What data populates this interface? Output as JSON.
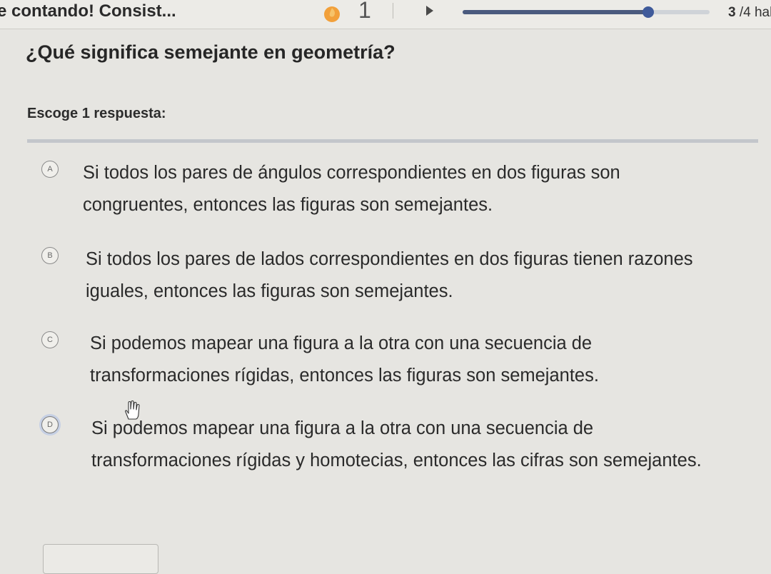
{
  "header": {
    "exercise_title": "e contando! Consist...",
    "streak_count": "1",
    "progress_fraction": 0.75,
    "counter_current": "3",
    "counter_rest": " /4 hab"
  },
  "question": {
    "prompt": "¿Qué signiﬁca semejante en geometría?",
    "instruction": "Escoge 1 respuesta:"
  },
  "choices": [
    {
      "letter": "A",
      "text": "Si todos los pares de ángulos correspondientes en dos ﬁguras son congruentes, entonces las ﬁguras son semejantes."
    },
    {
      "letter": "B",
      "text": "Si todos los pares de lados correspondientes en dos ﬁguras tienen razones iguales, entonces las ﬁguras son semejantes."
    },
    {
      "letter": "C",
      "text": "Si podemos mapear una ﬁgura a la otra con una secuencia de transformaciones rígidas, entonces las ﬁguras son semejantes."
    },
    {
      "letter": "D",
      "text": "Si podemos mapear una ﬁgura a la otra con una secuencia de transformaciones rígidas y homotecias, entonces las cifras son semejantes."
    }
  ],
  "colors": {
    "progress_fill": "#4a5a7e",
    "progress_knob": "#3f5a9a",
    "streak_flame": "#f2a03a"
  },
  "icons": {
    "streak": "flame-icon",
    "play": "play-icon",
    "cursor": "hand-cursor-icon"
  }
}
